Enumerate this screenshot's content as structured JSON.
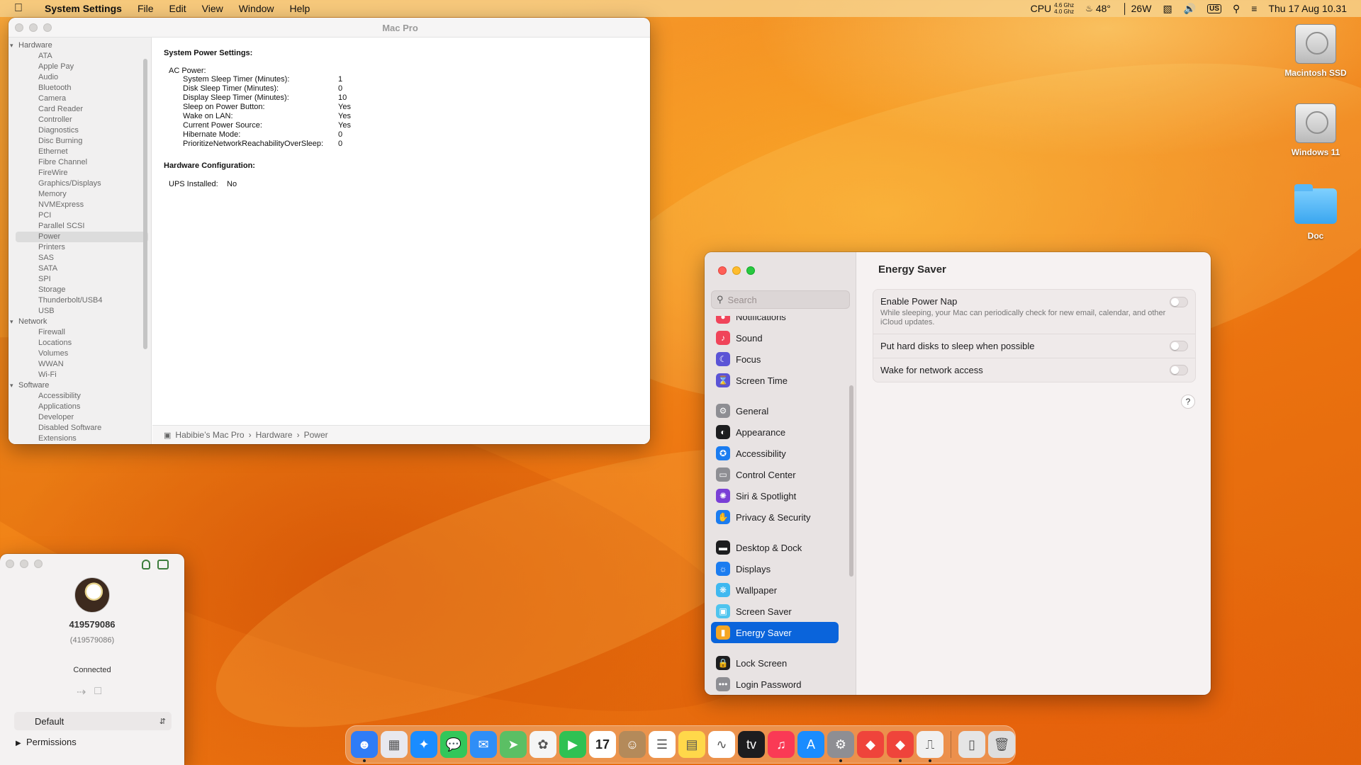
{
  "menubar": {
    "app_name": "System Settings",
    "menus": [
      "File",
      "Edit",
      "View",
      "Window",
      "Help"
    ],
    "status": {
      "cpu_label": "CPU",
      "cpu_freq_1": "4.6 Ghz",
      "cpu_freq_2": "4.0 Ghz",
      "temp": "48°",
      "power": "26W",
      "keyboard": "US",
      "datetime": "Thu 17 Aug  10.31"
    }
  },
  "sysinfo": {
    "title": "Mac Pro",
    "tree": {
      "hardware_label": "Hardware",
      "hardware": [
        "ATA",
        "Apple Pay",
        "Audio",
        "Bluetooth",
        "Camera",
        "Card Reader",
        "Controller",
        "Diagnostics",
        "Disc Burning",
        "Ethernet",
        "Fibre Channel",
        "FireWire",
        "Graphics/Displays",
        "Memory",
        "NVMExpress",
        "PCI",
        "Parallel SCSI",
        "Power",
        "Printers",
        "SAS",
        "SATA",
        "SPI",
        "Storage",
        "Thunderbolt/USB4",
        "USB"
      ],
      "network_label": "Network",
      "network": [
        "Firewall",
        "Locations",
        "Volumes",
        "WWAN",
        "Wi-Fi"
      ],
      "software_label": "Software",
      "software": [
        "Accessibility",
        "Applications",
        "Developer",
        "Disabled Software",
        "Extensions"
      ],
      "selected": "Power"
    },
    "content": {
      "heading1": "System Power Settings:",
      "ac_power_label": "AC Power:",
      "settings": [
        {
          "k": "System Sleep Timer (Minutes):",
          "v": "1"
        },
        {
          "k": "Disk Sleep Timer (Minutes):",
          "v": "0"
        },
        {
          "k": "Display Sleep Timer (Minutes):",
          "v": "10"
        },
        {
          "k": "Sleep on Power Button:",
          "v": "Yes"
        },
        {
          "k": "Wake on LAN:",
          "v": "Yes"
        },
        {
          "k": "Current Power Source:",
          "v": "Yes"
        },
        {
          "k": "Hibernate Mode:",
          "v": "0"
        },
        {
          "k": "PrioritizeNetworkReachabilityOverSleep:",
          "v": "0"
        }
      ],
      "heading2": "Hardware Configuration:",
      "ups_label": "UPS Installed:",
      "ups_value": "No"
    },
    "pathbar": [
      "Habibie’s Mac Pro",
      "›",
      "Hardware",
      "›",
      "Power"
    ]
  },
  "settings": {
    "search_placeholder": "Search",
    "partial_item": "Notifications",
    "sidebar": [
      {
        "label": "Sound",
        "icon": "sound-icon",
        "color": "#f0445a"
      },
      {
        "label": "Focus",
        "icon": "moon-icon",
        "color": "#5b54d6"
      },
      {
        "label": "Screen Time",
        "icon": "hourglass-icon",
        "color": "#5b54d6"
      },
      {
        "label": "General",
        "icon": "gear-icon",
        "color": "#8e8e93"
      },
      {
        "label": "Appearance",
        "icon": "appearance-icon",
        "color": "#1d1d1f"
      },
      {
        "label": "Accessibility",
        "icon": "accessibility-icon",
        "color": "#1b7cf0"
      },
      {
        "label": "Control Center",
        "icon": "control-center-icon",
        "color": "#8e8e93"
      },
      {
        "label": "Siri & Spotlight",
        "icon": "siri-icon",
        "color": "#7a3fd6"
      },
      {
        "label": "Privacy & Security",
        "icon": "hand-icon",
        "color": "#1b7cf0"
      },
      {
        "label": "Desktop & Dock",
        "icon": "dock-icon",
        "color": "#1d1d1f"
      },
      {
        "label": "Displays",
        "icon": "displays-icon",
        "color": "#1b7cf0"
      },
      {
        "label": "Wallpaper",
        "icon": "wallpaper-icon",
        "color": "#3fb8f0"
      },
      {
        "label": "Screen Saver",
        "icon": "screensaver-icon",
        "color": "#4fc4ee"
      },
      {
        "label": "Energy Saver",
        "icon": "battery-icon",
        "color": "#f5a623"
      },
      {
        "label": "Lock Screen",
        "icon": "lock-icon",
        "color": "#1d1d1f"
      },
      {
        "label": "Login Password",
        "icon": "password-icon",
        "color": "#8e8e93"
      }
    ],
    "selected": "Energy Saver",
    "page_title": "Energy Saver",
    "rows": [
      {
        "label": "Enable Power Nap",
        "desc": "While sleeping, your Mac can periodically check for new email, calendar, and other iCloud updates.",
        "on": false
      },
      {
        "label": "Put hard disks to sleep when possible",
        "desc": "",
        "on": false
      },
      {
        "label": "Wake for network access",
        "desc": "",
        "on": false
      }
    ],
    "help": "?"
  },
  "teamviewer": {
    "id": "419579086",
    "id_paren": "(419579086)",
    "status": "Connected",
    "profile": "Default",
    "permissions": "Permissions"
  },
  "desktop_icons": [
    "Macintosh SSD",
    "Windows 11",
    "Doc"
  ],
  "dock": [
    {
      "name": "finder-icon",
      "color": "#2f7cf6",
      "glyph": "☻",
      "dot": true
    },
    {
      "name": "launchpad-icon",
      "color": "#e8e8ee",
      "glyph": "▦",
      "dot": false
    },
    {
      "name": "safari-icon",
      "color": "#1a8cff",
      "glyph": "✦",
      "dot": false
    },
    {
      "name": "messages-icon",
      "color": "#32c75a",
      "glyph": "💬",
      "dot": false
    },
    {
      "name": "mail-icon",
      "color": "#2f8ef7",
      "glyph": "✉",
      "dot": false
    },
    {
      "name": "maps-icon",
      "color": "#5bbf64",
      "glyph": "➤",
      "dot": false
    },
    {
      "name": "photos-icon",
      "color": "#f5f5f5",
      "glyph": "✿",
      "dot": false
    },
    {
      "name": "facetime-icon",
      "color": "#2fc153",
      "glyph": "▶",
      "dot": false
    },
    {
      "name": "calendar-icon",
      "color": "#ffffff",
      "glyph": "17",
      "dot": false
    },
    {
      "name": "contacts-icon",
      "color": "#b48a5a",
      "glyph": "☺",
      "dot": false
    },
    {
      "name": "reminders-icon",
      "color": "#ffffff",
      "glyph": "☰",
      "dot": false
    },
    {
      "name": "notes-icon",
      "color": "#ffd84a",
      "glyph": "▤",
      "dot": false
    },
    {
      "name": "freeform-icon",
      "color": "#ffffff",
      "glyph": "∿",
      "dot": false
    },
    {
      "name": "tv-icon",
      "color": "#1d1d1f",
      "glyph": "tv",
      "dot": false
    },
    {
      "name": "music-icon",
      "color": "#fa3a55",
      "glyph": "♫",
      "dot": false
    },
    {
      "name": "appstore-icon",
      "color": "#1a8cff",
      "glyph": "A",
      "dot": false
    },
    {
      "name": "system-settings-icon",
      "color": "#8e8e93",
      "glyph": "⚙",
      "dot": true
    },
    {
      "name": "anydesk-icon",
      "color": "#ef443b",
      "glyph": "◆",
      "dot": false
    },
    {
      "name": "anydesk-2-icon",
      "color": "#ef443b",
      "glyph": "◆",
      "dot": true
    },
    {
      "name": "system-information-icon",
      "color": "#f0f0f0",
      "glyph": "⎍",
      "dot": true
    },
    {
      "name": "documents-icon",
      "color": "#e5e5e5",
      "glyph": "▯",
      "dot": false
    },
    {
      "name": "trash-icon",
      "color": "#dedede",
      "glyph": "🗑",
      "dot": false
    }
  ]
}
